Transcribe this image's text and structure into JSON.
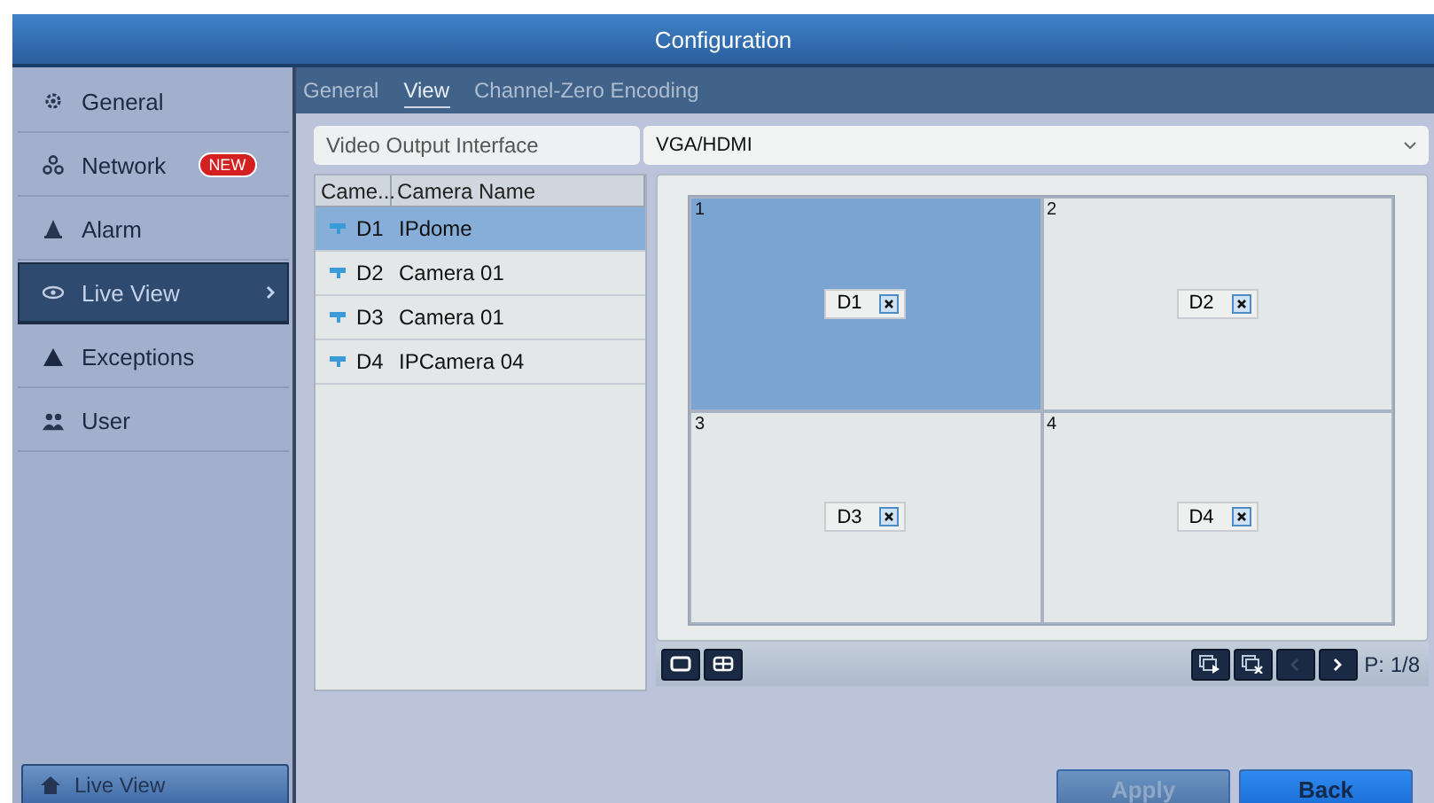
{
  "window": {
    "title": "Configuration"
  },
  "sidebar": {
    "items": [
      {
        "label": "General",
        "selected": false
      },
      {
        "label": "Network",
        "badge": "NEW",
        "selected": false
      },
      {
        "label": "Alarm",
        "selected": false
      },
      {
        "label": "Live View",
        "selected": true
      },
      {
        "label": "Exceptions",
        "selected": false
      },
      {
        "label": "User",
        "selected": false
      }
    ],
    "footer_button": "Live View"
  },
  "tabs": [
    {
      "label": "General",
      "selected": false
    },
    {
      "label": "View",
      "selected": true
    },
    {
      "label": "Channel-Zero Encoding",
      "selected": false
    }
  ],
  "video_output": {
    "label": "Video Output Interface",
    "value": "VGA/HDMI"
  },
  "camera_table": {
    "columns": [
      "Came...",
      "Camera Name"
    ],
    "rows": [
      {
        "no": "D1",
        "name": "IPdome",
        "selected": true
      },
      {
        "no": "D2",
        "name": "Camera 01",
        "selected": false
      },
      {
        "no": "D3",
        "name": "Camera 01",
        "selected": false
      },
      {
        "no": "D4",
        "name": "IPCamera 04",
        "selected": false
      }
    ]
  },
  "view_windows": [
    {
      "number": "1",
      "camera": "D1",
      "selected": true
    },
    {
      "number": "2",
      "camera": "D2",
      "selected": false
    },
    {
      "number": "3",
      "camera": "D3",
      "selected": false
    },
    {
      "number": "4",
      "camera": "D4",
      "selected": false
    }
  ],
  "toolbar": {
    "page": "P: 1/8"
  },
  "buttons": [
    {
      "label": "Apply",
      "disabled": true,
      "kind": "apply"
    },
    {
      "label": "Back",
      "disabled": false,
      "kind": "back"
    }
  ]
}
